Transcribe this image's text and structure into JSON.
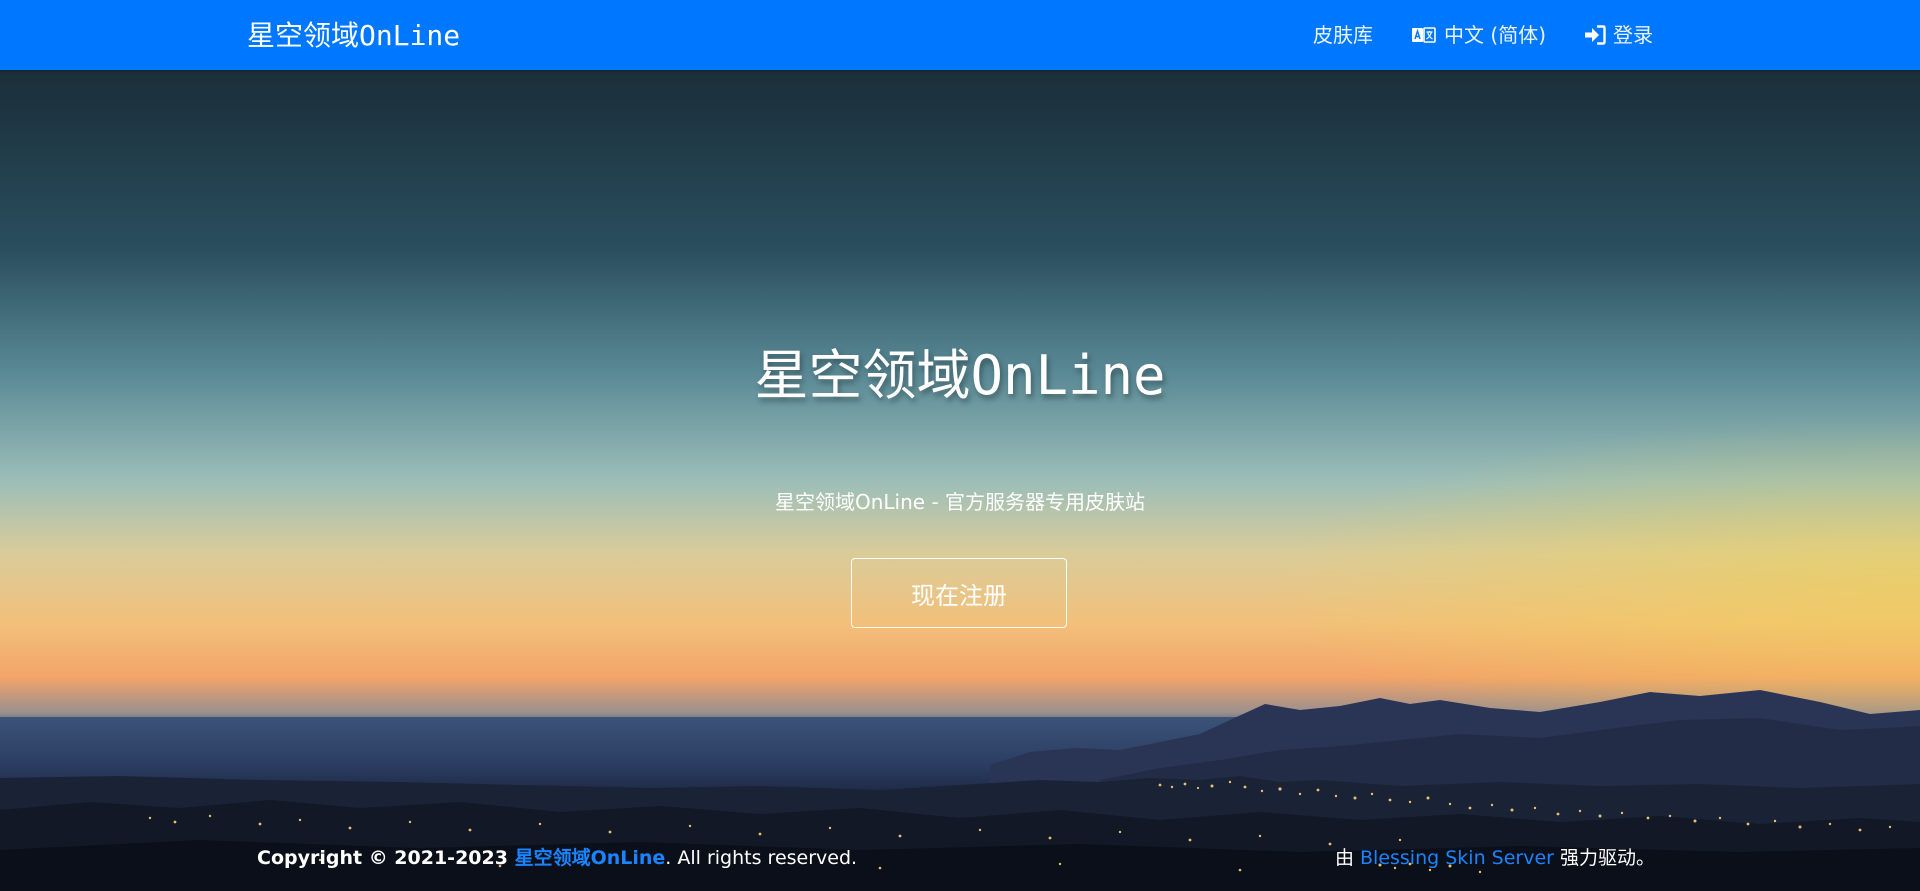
{
  "navbar": {
    "brand": "星空领域OnLine",
    "skin_library": "皮肤库",
    "language": "中文 (简体)",
    "login": "登录",
    "background_color": "#0077ff"
  },
  "icons": {
    "language": "language-icon",
    "login": "sign-in-icon"
  },
  "hero": {
    "title": "星空领域OnLine",
    "subtitle": "星空领域OnLine - 官方服务器专用皮肤站",
    "register_button": "现在注册"
  },
  "footer": {
    "copyright_prefix": "Copyright © 2021-2023 ",
    "site_name": "星空领域OnLine",
    "copyright_suffix": ". All rights reserved.",
    "powered_prefix": "由 ",
    "powered_link": "Blessing Skin Server",
    "powered_suffix": " 强力驱动。",
    "link_color": "#1a84ff"
  }
}
